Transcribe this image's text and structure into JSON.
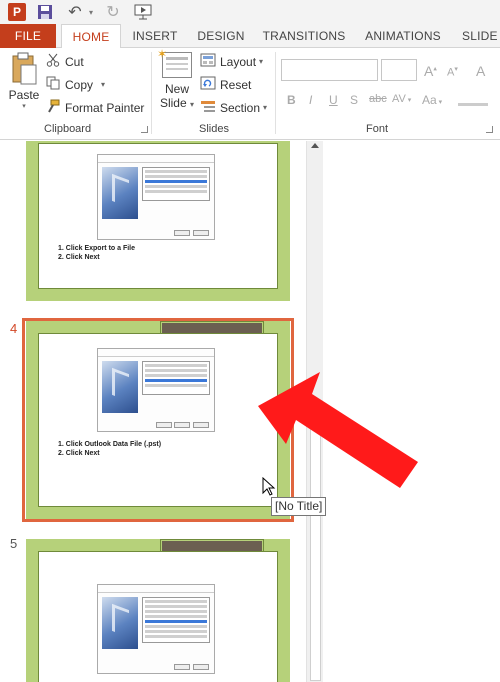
{
  "quick_access": {
    "icons": [
      "powerpoint-logo",
      "save-icon",
      "undo-icon",
      "redo-icon",
      "from-beginning-icon"
    ],
    "logo_letter": "P"
  },
  "tabs": {
    "file": "FILE",
    "home": "HOME",
    "insert": "INSERT",
    "design": "DESIGN",
    "transitions": "TRANSITIONS",
    "animations": "ANIMATIONS",
    "slideshow": "SLIDE S"
  },
  "ribbon": {
    "clipboard": {
      "label": "Clipboard",
      "paste": "Paste",
      "cut": "Cut",
      "copy": "Copy",
      "format_painter": "Format Painter"
    },
    "slides": {
      "label": "Slides",
      "new_slide_line1": "New",
      "new_slide_line2": "Slide",
      "layout": "Layout",
      "reset": "Reset",
      "section": "Section"
    },
    "font": {
      "label": "Font",
      "grow": "A",
      "shrink": "A",
      "clear": "A",
      "bold": "B",
      "italic": "I",
      "underline": "U",
      "shadow": "S",
      "strike": "abc",
      "spacing": "AV",
      "case": "Aa"
    }
  },
  "colors": {
    "accent": "#c43e1c",
    "selection": "#e0663f",
    "slide_bg": "#b6d17a",
    "title_bar": "#6b5f51"
  },
  "slides": [
    {
      "number": "",
      "bullets": [
        "1.  Click Export to a File",
        "2.  Click Next"
      ]
    },
    {
      "number": "4",
      "selected": true,
      "bullets": [
        "1.  Click Outlook Data File (.pst)",
        "2.  Click Next"
      ]
    },
    {
      "number": "5",
      "bullets": []
    }
  ],
  "tooltip": "[No Title]"
}
